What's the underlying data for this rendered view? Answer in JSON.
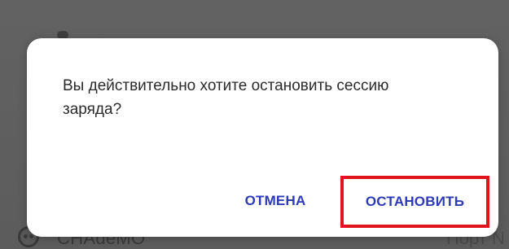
{
  "dialog": {
    "message": "Вы действительно хотите остановить сессию заряда?",
    "cancel_label": "ОТМЕНА",
    "stop_label": "ОСТАНОВИТЬ"
  },
  "background": {
    "connector_name": "CHAdeMO",
    "port_label": "Порт N"
  },
  "colors": {
    "accent": "#2e3bb5",
    "highlight": "#e0131f",
    "overlay": "#5f5f5f"
  },
  "icons": [
    "connector-icon"
  ]
}
